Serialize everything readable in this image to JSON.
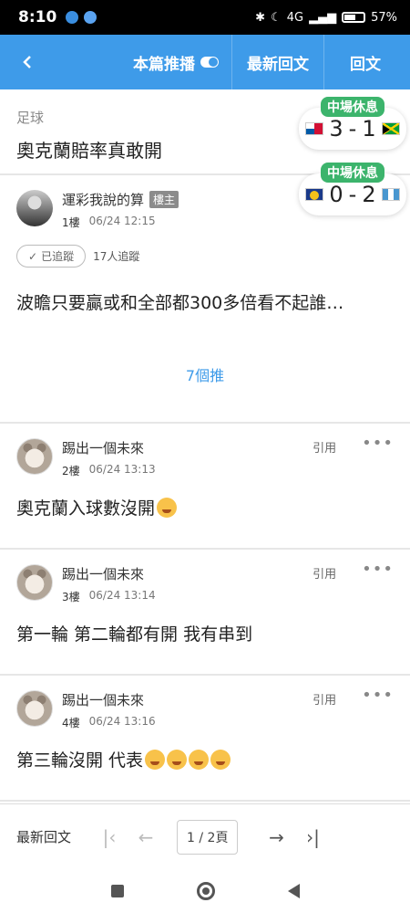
{
  "status_bar": {
    "time": "8:10",
    "network": "4G",
    "battery": "57%"
  },
  "app_bar": {
    "push_label": "本篇推播",
    "latest_label": "最新回文",
    "reply_label": "回文"
  },
  "topic": {
    "category": "足球",
    "title": "奧克蘭賠率真敢開"
  },
  "scores": [
    {
      "badge": "中場休息",
      "home_score": "3",
      "separator": "-",
      "away_score": "1",
      "home_flag": "panama-flag-icon",
      "away_flag": "jamaica-flag-icon"
    },
    {
      "badge": "中場休息",
      "home_score": "0",
      "separator": "-",
      "away_score": "2",
      "home_flag": "solomon-islands-flag-icon",
      "away_flag": "guatemala-flag-icon"
    }
  ],
  "main_post": {
    "author": "運彩我說的算",
    "host_tag": "樓主",
    "floor": "1樓",
    "time": "06/24 12:15",
    "follow_label": "已追蹤",
    "follow_count": "17人追蹤",
    "body": "波瞻只要贏或和全部都300多倍看不起誰…",
    "recommend": "7個推"
  },
  "replies": [
    {
      "author": "踢出一個未來",
      "floor": "2樓",
      "time": "06/24 13:13",
      "body": "奧克蘭入球數沒開",
      "quote_label": "引用",
      "emojis": [
        "smiling-hearts-emoji"
      ]
    },
    {
      "author": "踢出一個未來",
      "floor": "3樓",
      "time": "06/24 13:14",
      "body": "第一輪 第二輪都有開 我有串到",
      "quote_label": "引用",
      "emojis": []
    },
    {
      "author": "踢出一個未來",
      "floor": "4樓",
      "time": "06/24 13:16",
      "body": "第三輪沒開 代表",
      "quote_label": "引用",
      "emojis": [
        "hand-over-mouth-emoji",
        "hand-over-mouth-emoji",
        "grinning-emoji",
        "grinning-emoji"
      ]
    }
  ],
  "more_label": "•••",
  "bottom_bar": {
    "latest_label": "最新回文",
    "page_label": "1 / 2頁"
  },
  "colors": {
    "accent": "#3e9be9",
    "badge_green": "#3cb46c"
  }
}
